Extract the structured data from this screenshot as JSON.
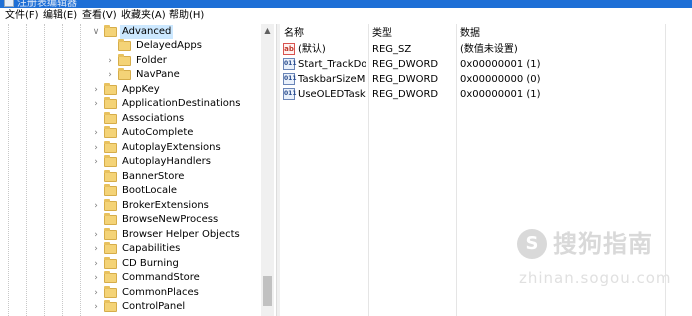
{
  "window": {
    "title": "注册表编辑器"
  },
  "menu": [
    "文件(F)",
    "编辑(E)",
    "查看(V)",
    "收藏夹(A)",
    "帮助(H)"
  ],
  "tree": {
    "nodes": [
      {
        "label": "Advanced",
        "expanded": true,
        "selected": true,
        "level": 0
      },
      {
        "label": "DelayedApps",
        "expanded": false,
        "has_children": false,
        "level": 1
      },
      {
        "label": "Folder",
        "has_children": true,
        "level": 1
      },
      {
        "label": "NavPane",
        "has_children": true,
        "level": 1
      },
      {
        "label": "AppKey",
        "has_children": true,
        "level": 0
      },
      {
        "label": "ApplicationDestinations",
        "has_children": true,
        "level": 0
      },
      {
        "label": "Associations",
        "has_children": false,
        "level": 0
      },
      {
        "label": "AutoComplete",
        "has_children": true,
        "level": 0
      },
      {
        "label": "AutoplayExtensions",
        "has_children": true,
        "level": 0
      },
      {
        "label": "AutoplayHandlers",
        "has_children": true,
        "level": 0
      },
      {
        "label": "BannerStore",
        "has_children": false,
        "level": 0
      },
      {
        "label": "BootLocale",
        "has_children": false,
        "level": 0
      },
      {
        "label": "BrokerExtensions",
        "has_children": true,
        "level": 0
      },
      {
        "label": "BrowseNewProcess",
        "has_children": false,
        "level": 0
      },
      {
        "label": "Browser Helper Objects",
        "has_children": true,
        "level": 0
      },
      {
        "label": "Capabilities",
        "has_children": true,
        "level": 0
      },
      {
        "label": "CD Burning",
        "has_children": true,
        "level": 0
      },
      {
        "label": "CommandStore",
        "has_children": true,
        "level": 0
      },
      {
        "label": "CommonPlaces",
        "has_children": true,
        "level": 0
      },
      {
        "label": "ControlPanel",
        "has_children": true,
        "level": 0
      }
    ]
  },
  "list": {
    "headers": [
      "名称",
      "类型",
      "数据"
    ],
    "rows": [
      {
        "icon": "string-value-icon",
        "name": "(默认)",
        "type": "REG_SZ",
        "data": "(数值未设置)"
      },
      {
        "icon": "dword-value-icon",
        "name": "Start_TrackDocs",
        "type": "REG_DWORD",
        "data": "0x00000001 (1)"
      },
      {
        "icon": "dword-value-icon",
        "name": "TaskbarSizeM...",
        "type": "REG_DWORD",
        "data": "0x00000000 (0)"
      },
      {
        "icon": "dword-value-icon",
        "name": "UseOLEDTask...",
        "type": "REG_DWORD",
        "data": "0x00000001 (1)"
      }
    ]
  },
  "watermark": {
    "brand": "搜狗指南",
    "site": "zhinan.sogou.com"
  },
  "colors": {
    "titlebar": "#1e6fd6",
    "selection": "#cce8ff",
    "folder": "#f4d377"
  }
}
